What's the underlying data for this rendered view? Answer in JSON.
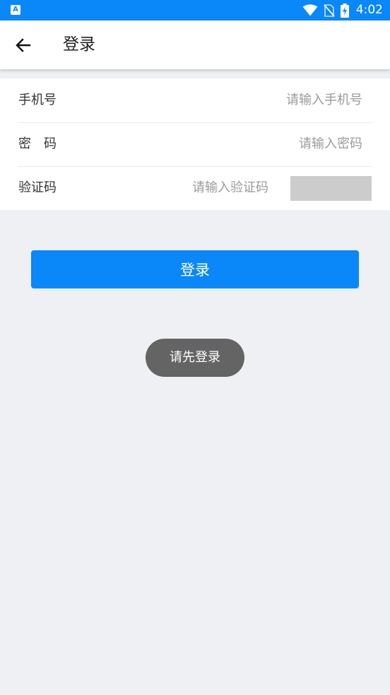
{
  "status_bar": {
    "app_icon_glyph": "A",
    "time": "4:02",
    "icons": [
      "wifi-icon",
      "no-sim-icon",
      "battery-charging-icon"
    ]
  },
  "header": {
    "back_icon": "arrow-left-icon",
    "title": "登录"
  },
  "form": {
    "phone": {
      "label": "手机号",
      "placeholder": "请输入手机号",
      "value": ""
    },
    "password": {
      "label": "密　码",
      "placeholder": "请输入密码",
      "value": ""
    },
    "captcha": {
      "label": "验证码",
      "placeholder": "请输入验证码",
      "value": ""
    }
  },
  "login_button": {
    "label": "登录"
  },
  "toast": {
    "message": "请先登录"
  },
  "colors": {
    "primary": "#0a87f8",
    "background": "#eff0f4",
    "toast": "#646464",
    "captcha_placeholder": "#cccccc"
  }
}
